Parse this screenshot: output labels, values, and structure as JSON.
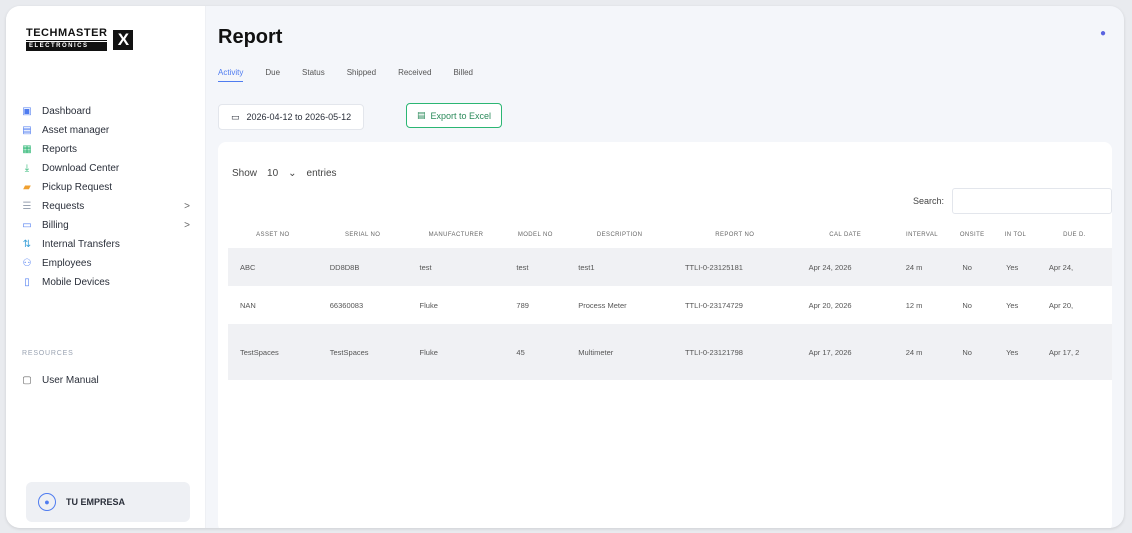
{
  "brand": {
    "top": "TECHMASTER",
    "bottom": "ELECTRONICS",
    "mark": "X"
  },
  "sidebar": {
    "items": [
      {
        "label": "Dashboard",
        "icon": "dashboard-icon"
      },
      {
        "label": "Asset manager",
        "icon": "asset-icon"
      },
      {
        "label": "Reports",
        "icon": "reports-icon"
      },
      {
        "label": "Download Center",
        "icon": "download-icon"
      },
      {
        "label": "Pickup Request",
        "icon": "pickup-icon"
      },
      {
        "label": "Requests",
        "icon": "requests-icon",
        "chevron": ">"
      },
      {
        "label": "Billing",
        "icon": "billing-icon",
        "chevron": ">"
      },
      {
        "label": "Internal Transfers",
        "icon": "transfer-icon"
      },
      {
        "label": "Employees",
        "icon": "employees-icon"
      },
      {
        "label": "Mobile Devices",
        "icon": "mobile-icon"
      }
    ],
    "resources_label": "RESOURCES",
    "manual_label": "User Manual",
    "company_name": "TU EMPRESA"
  },
  "page": {
    "title": "Report"
  },
  "tabs": [
    "Activity",
    "Due",
    "Status",
    "Shipped",
    "Received",
    "Billed"
  ],
  "filters": {
    "date_range": "2026-04-12 to 2026-05-12",
    "export_label": "Export to Excel"
  },
  "table": {
    "show_label": "Show",
    "entries_value": "10",
    "entries_label": "entries",
    "search_label": "Search:",
    "columns": [
      "ASSET NO",
      "SERIAL NO",
      "MANUFACTURER",
      "MODEL NO",
      "DESCRIPTION",
      "REPORT NO",
      "CAL DATE",
      "INTERVAL",
      "ONSITE",
      "IN TOL",
      "DUE D."
    ],
    "rows": [
      [
        "ABC",
        "DD8D8B",
        "test",
        "test",
        "test1",
        "TTLI-0-23125181",
        "Apr 24, 2026",
        "24 m",
        "No",
        "Yes",
        "Apr 24,"
      ],
      [
        "NAN",
        "66360083",
        "Fluke",
        "789",
        "Process Meter",
        "TTLI-0-23174729",
        "Apr 20, 2026",
        "12 m",
        "No",
        "Yes",
        "Apr 20,"
      ],
      [
        "TestSpaces",
        "TestSpaces",
        "Fluke",
        "45",
        "Multimeter",
        "TTLI-0-23121798",
        "Apr 17, 2026",
        "24 m",
        "No",
        "Yes",
        "Apr 17, 2"
      ]
    ]
  },
  "colors": {
    "accent": "#4f7cf0",
    "export": "#2bb673"
  }
}
